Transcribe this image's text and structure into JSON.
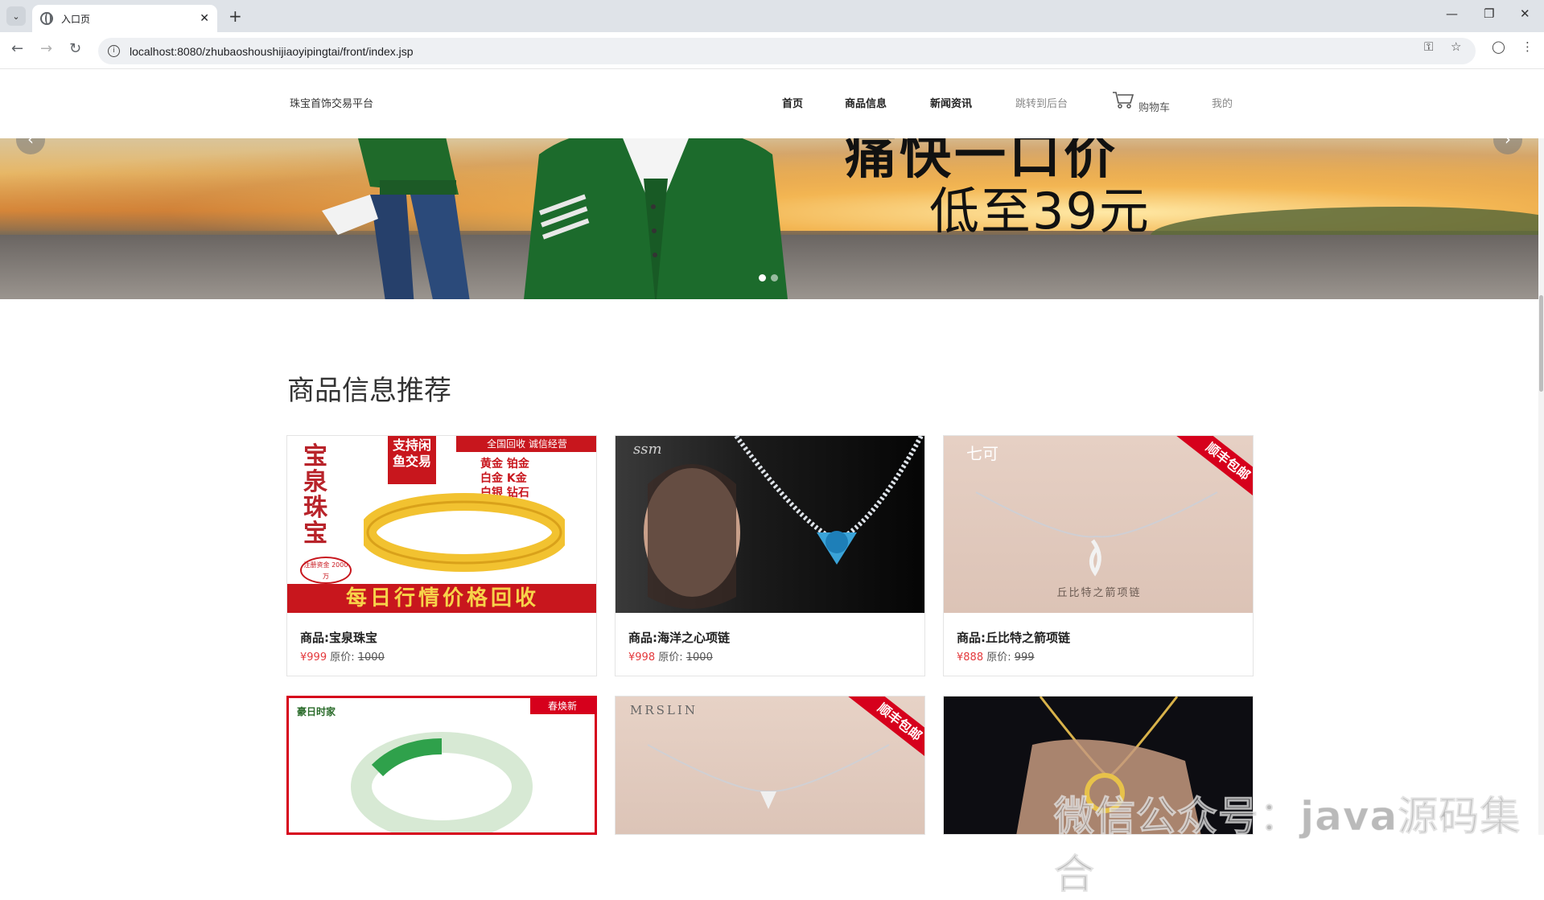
{
  "browser": {
    "tab_title": "入口页",
    "url": "localhost:8080/zhubaoshoushijiaoyipingtai/front/index.jsp"
  },
  "header": {
    "brand": "珠宝首饰交易平台",
    "nav": [
      "首页",
      "商品信息",
      "新闻资讯",
      "跳转到后台",
      "购物车",
      "我的"
    ]
  },
  "banner": {
    "headline": "痛快一口价",
    "subline": "低至39元",
    "slides": 2,
    "active_slide": 1
  },
  "section": {
    "title": "商品信息推荐"
  },
  "products": [
    {
      "name": "商品:宝泉珠宝",
      "price": "¥999",
      "orig_label": "原价:",
      "orig_price": "1000",
      "img_text": {
        "side": "宝泉珠宝",
        "top": "支持闲鱼交易",
        "red": "全国回收 诚信经营",
        "items": [
          "黄金 铂金",
          "白金 K金",
          "白银 钻石"
        ],
        "bottom": "每日行情价格回收",
        "badge": "注册资金 2000万"
      }
    },
    {
      "name": "商品:海洋之心项链",
      "price": "¥998",
      "orig_label": "原价:",
      "orig_price": "1000",
      "img_text": {
        "logo": "ssm"
      }
    },
    {
      "name": "商品:丘比特之箭项链",
      "price": "¥888",
      "orig_label": "原价:",
      "orig_price": "999",
      "img_text": {
        "logo": "七可",
        "ribbon": "顺丰包邮",
        "caption": "丘比特之箭项链"
      }
    },
    {
      "name": "",
      "price": "",
      "orig_label": "",
      "orig_price": "",
      "img_text": {
        "logo": "豪日时家",
        "ribbon": "春焕新"
      }
    },
    {
      "name": "",
      "price": "",
      "orig_label": "",
      "orig_price": "",
      "img_text": {
        "logo": "MRSLIN",
        "ribbon": "顺丰包邮"
      }
    },
    {
      "name": "",
      "price": "",
      "orig_label": "",
      "orig_price": "",
      "img_text": {
        "logo": ""
      }
    }
  ],
  "watermark": "微信公众号：java源码集合",
  "colors": {
    "price_red": "#e4393c",
    "ribbon_red": "#d6001c",
    "gold": "#f2c230"
  }
}
